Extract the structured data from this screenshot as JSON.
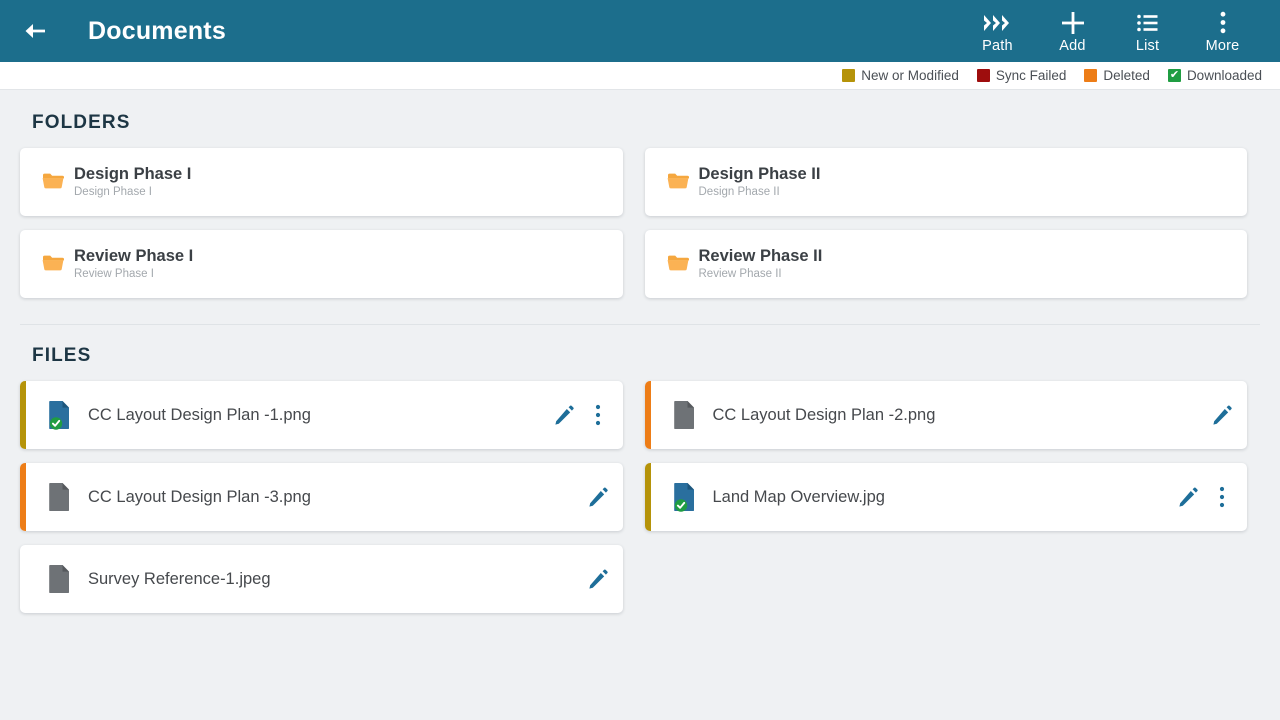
{
  "appbar": {
    "back_icon": "arrow-left-icon",
    "title": "Documents",
    "actions": [
      {
        "icon": "path-chevrons-icon",
        "label": "Path"
      },
      {
        "icon": "plus-icon",
        "label": "Add"
      },
      {
        "icon": "list-icon",
        "label": "List"
      },
      {
        "icon": "more-vertical-icon",
        "label": "More"
      }
    ],
    "bg_color": "#1c6e8c"
  },
  "legend": {
    "items": [
      {
        "label": "New or Modified",
        "color": "#b59309",
        "type": "swatch"
      },
      {
        "label": "Sync Failed",
        "color": "#9e0d0d",
        "type": "swatch"
      },
      {
        "label": "Deleted",
        "color": "#ed7d17",
        "type": "swatch"
      },
      {
        "label": "Downloaded",
        "color": "#1f9d42",
        "type": "check",
        "glyph": "✔"
      }
    ]
  },
  "folders_section": {
    "title": "FOLDERS",
    "items": [
      {
        "name": "Design Phase I",
        "subtitle": "Design Phase I"
      },
      {
        "name": "Design Phase II",
        "subtitle": "Design Phase II"
      },
      {
        "name": "Review Phase I",
        "subtitle": "Review Phase I"
      },
      {
        "name": "Review Phase II",
        "subtitle": "Review Phase II"
      }
    ],
    "folder_color": "#f5a73f"
  },
  "files_section": {
    "title": "FILES",
    "items": [
      {
        "name": "CC Layout Design Plan -1.png",
        "status": "New or Modified",
        "stripe_color": "#b59309",
        "downloaded": true,
        "icon_color": "#2a6f9e",
        "has_edit": true,
        "has_more": true
      },
      {
        "name": "CC Layout Design Plan -2.png",
        "status": "Deleted",
        "stripe_color": "#ed7d17",
        "downloaded": false,
        "icon_color": "#6e7276",
        "has_edit": true,
        "has_more": false
      },
      {
        "name": "CC Layout Design Plan -3.png",
        "status": "Deleted",
        "stripe_color": "#ed7d17",
        "downloaded": false,
        "icon_color": "#6e7276",
        "has_edit": true,
        "has_more": false
      },
      {
        "name": "Land Map Overview.jpg",
        "status": "New or Modified",
        "stripe_color": "#b59309",
        "downloaded": true,
        "icon_color": "#2a6f9e",
        "has_edit": true,
        "has_more": true
      },
      {
        "name": "Survey Reference-1.jpeg",
        "status": "",
        "stripe_color": "transparent",
        "downloaded": false,
        "icon_color": "#6e7276",
        "has_edit": true,
        "has_more": false
      }
    ],
    "edit_icon": "pencil-icon",
    "more_icon": "more-vertical-icon",
    "downloaded_badge_color": "#1f9d42",
    "action_color": "#1e6e99"
  }
}
